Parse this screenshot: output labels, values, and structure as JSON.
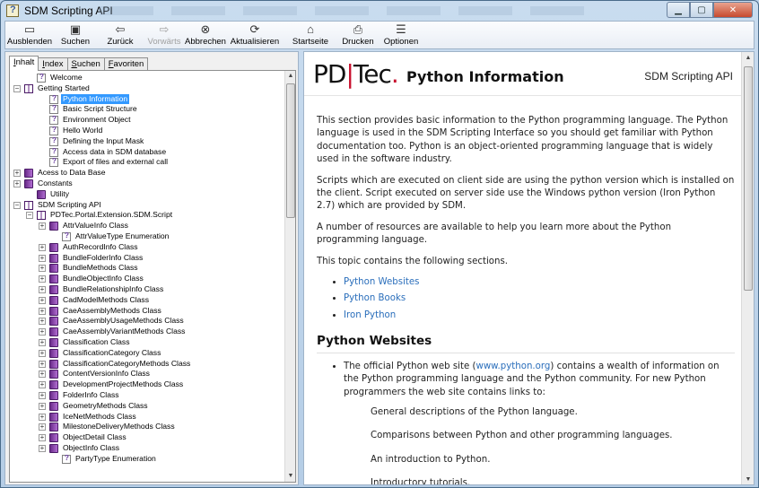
{
  "window": {
    "title": "SDM Scripting API"
  },
  "toolbar": [
    {
      "name": "ausblenden-button",
      "label": "Ausblenden",
      "icon": "hide-pane-icon",
      "glyph": "▭",
      "enabled": true
    },
    {
      "name": "suchen-button",
      "label": "Suchen",
      "icon": "search-icon",
      "glyph": "▣",
      "enabled": true
    },
    {
      "name": "zurueck-button",
      "label": "Zurück",
      "icon": "back-arrow-icon",
      "glyph": "⇦",
      "enabled": true
    },
    {
      "name": "vorwaerts-button",
      "label": "Vorwärts",
      "icon": "forward-arrow-icon",
      "glyph": "⇨",
      "enabled": false
    },
    {
      "name": "abbrechen-button",
      "label": "Abbrechen",
      "icon": "stop-icon",
      "glyph": "⊗",
      "enabled": true
    },
    {
      "name": "aktualisieren-button",
      "label": "Aktualisieren",
      "icon": "refresh-icon",
      "glyph": "⟳",
      "enabled": true
    },
    {
      "name": "startseite-button",
      "label": "Startseite",
      "icon": "home-icon",
      "glyph": "⌂",
      "enabled": true
    },
    {
      "name": "drucken-button",
      "label": "Drucken",
      "icon": "printer-icon",
      "glyph": "⎙",
      "enabled": true
    },
    {
      "name": "optionen-button",
      "label": "Optionen",
      "icon": "options-icon",
      "glyph": "☰",
      "enabled": true
    }
  ],
  "tabs": [
    {
      "name": "tab-inhalt",
      "first": "I",
      "rest": "nhalt",
      "active": true
    },
    {
      "name": "tab-index",
      "first": "I",
      "rest": "ndex",
      "active": false
    },
    {
      "name": "tab-suchen",
      "first": "S",
      "rest": "uchen",
      "active": false
    },
    {
      "name": "tab-favoriten",
      "first": "F",
      "rest": "avoriten",
      "active": false
    }
  ],
  "tree": [
    {
      "label": "Welcome",
      "level": 1,
      "icon": "page",
      "exp": ""
    },
    {
      "label": "Getting Started",
      "level": 0,
      "icon": "bookopen",
      "exp": "-"
    },
    {
      "label": "Python Information",
      "level": 2,
      "icon": "page",
      "exp": "",
      "selected": true
    },
    {
      "label": "Basic Script Structure",
      "level": 2,
      "icon": "page",
      "exp": ""
    },
    {
      "label": "Environment Object",
      "level": 2,
      "icon": "page",
      "exp": ""
    },
    {
      "label": "Hello World",
      "level": 2,
      "icon": "page",
      "exp": ""
    },
    {
      "label": "Defining the Input Mask",
      "level": 2,
      "icon": "page",
      "exp": ""
    },
    {
      "label": "Access data in SDM database",
      "level": 2,
      "icon": "page",
      "exp": ""
    },
    {
      "label": "Export of files and external call",
      "level": 2,
      "icon": "page",
      "exp": ""
    },
    {
      "label": "Acess to Data Base",
      "level": 0,
      "icon": "book",
      "exp": "+"
    },
    {
      "label": "Constants",
      "level": 0,
      "icon": "book",
      "exp": "+"
    },
    {
      "label": "Utility",
      "level": 1,
      "icon": "book",
      "exp": ""
    },
    {
      "label": "SDM Scripting API",
      "level": 0,
      "icon": "bookopen",
      "exp": "-"
    },
    {
      "label": "PDTec.Portal.Extension.SDM.Script",
      "level": 1,
      "icon": "bookopen",
      "exp": "-"
    },
    {
      "label": "AttrValueInfo Class",
      "level": 2,
      "icon": "book",
      "exp": "+"
    },
    {
      "label": "AttrValueType Enumeration",
      "level": 3,
      "icon": "page",
      "exp": ""
    },
    {
      "label": "AuthRecordInfo Class",
      "level": 2,
      "icon": "book",
      "exp": "+"
    },
    {
      "label": "BundleFolderInfo Class",
      "level": 2,
      "icon": "book",
      "exp": "+"
    },
    {
      "label": "BundleMethods Class",
      "level": 2,
      "icon": "book",
      "exp": "+"
    },
    {
      "label": "BundleObjectInfo Class",
      "level": 2,
      "icon": "book",
      "exp": "+"
    },
    {
      "label": "BundleRelationshipInfo Class",
      "level": 2,
      "icon": "book",
      "exp": "+"
    },
    {
      "label": "CadModelMethods Class",
      "level": 2,
      "icon": "book",
      "exp": "+"
    },
    {
      "label": "CaeAssemblyMethods Class",
      "level": 2,
      "icon": "book",
      "exp": "+"
    },
    {
      "label": "CaeAssemblyUsageMethods Class",
      "level": 2,
      "icon": "book",
      "exp": "+"
    },
    {
      "label": "CaeAssemblyVariantMethods Class",
      "level": 2,
      "icon": "book",
      "exp": "+"
    },
    {
      "label": "Classification Class",
      "level": 2,
      "icon": "book",
      "exp": "+"
    },
    {
      "label": "ClassificationCategory Class",
      "level": 2,
      "icon": "book",
      "exp": "+"
    },
    {
      "label": "ClassificationCategoryMethods Class",
      "level": 2,
      "icon": "book",
      "exp": "+"
    },
    {
      "label": "ContentVersionInfo Class",
      "level": 2,
      "icon": "book",
      "exp": "+"
    },
    {
      "label": "DevelopmentProjectMethods Class",
      "level": 2,
      "icon": "book",
      "exp": "+"
    },
    {
      "label": "FolderInfo Class",
      "level": 2,
      "icon": "book",
      "exp": "+"
    },
    {
      "label": "GeometryMethods Class",
      "level": 2,
      "icon": "book",
      "exp": "+"
    },
    {
      "label": "IceNetMethods Class",
      "level": 2,
      "icon": "book",
      "exp": "+"
    },
    {
      "label": "MilestoneDeliveryMethods Class",
      "level": 2,
      "icon": "book",
      "exp": "+"
    },
    {
      "label": "ObjectDetail Class",
      "level": 2,
      "icon": "book",
      "exp": "+"
    },
    {
      "label": "ObjectInfo Class",
      "level": 2,
      "icon": "book",
      "exp": "+"
    },
    {
      "label": "PartyType Enumeration",
      "level": 3,
      "icon": "page",
      "exp": ""
    }
  ],
  "doc": {
    "logo_a": "PD",
    "logo_sep": "|",
    "logo_b": "Tec",
    "logo_dot": ".",
    "title": "Python Information",
    "api_label": "SDM Scripting API",
    "p1": "This section provides basic information to the Python programming language. The Python language is used in the SDM Scripting Interface so you should get familiar with Python documentation too. Python is an object-oriented programming language that is widely used in the software industry.",
    "p2": "Scripts which are executed on client side are using the python version which is installed on the client. Script executed on server side use the Windows python version (Iron Python 2.7) which are provided by SDM.",
    "p3": "A number of resources are available to help you learn more about the Python programming language.",
    "p4": "This topic contains the following sections.",
    "links": [
      "Python Websites",
      "Python Books",
      "Iron Python"
    ],
    "h2": "Python Websites",
    "li_pre": "The official Python web site (",
    "li_link": "www.python.org",
    "li_post": ") contains a wealth of information on the Python programming language and the Python community. For new Python programmers the web site contains links to:",
    "subs": [
      "General descriptions of the Python language.",
      "Comparisons between Python and other programming languages.",
      "An introduction to Python.",
      "Introductory tutorials."
    ]
  }
}
